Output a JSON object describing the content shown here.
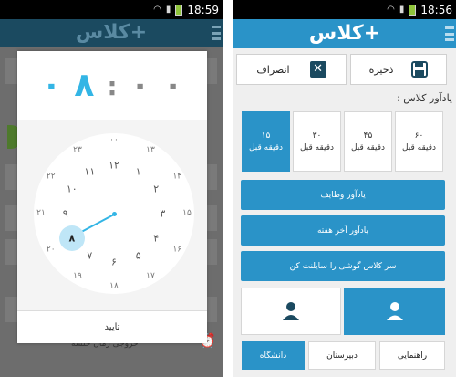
{
  "left": {
    "status_time": "18:59",
    "logo": "کلاس+",
    "time": {
      "hour_tens": "۰",
      "hour_ones": "۸",
      "colon": ":",
      "minute_tens": "۰",
      "minute_ones": "۰"
    },
    "clock": {
      "outer": [
        "۱۲",
        "۱",
        "۲",
        "۳",
        "۴",
        "۵",
        "۶",
        "۷",
        "۸",
        "۹",
        "۱۰",
        "۱۱"
      ],
      "inner": [
        "۰۰",
        "۱۳",
        "۱۴",
        "۱۵",
        "۱۶",
        "۱۷",
        "۱۸",
        "۱۹",
        "۲۰",
        "۲۱",
        "۲۲",
        "۲۳"
      ],
      "selected_hour": 8
    },
    "confirm_label": "تایید",
    "background_footer": "خروجی زمان جلسه"
  },
  "right": {
    "status_time": "18:56",
    "logo": "کلاس+",
    "save_label": "ذخیره",
    "cancel_label": "انصراف",
    "reminder_title": "یادآور کلاس :",
    "reminders": [
      {
        "value": "۶۰",
        "unit": "دقیقه قبل",
        "selected": false
      },
      {
        "value": "۴۵",
        "unit": "دقیقه قبل",
        "selected": false
      },
      {
        "value": "۳۰",
        "unit": "دقیقه قبل",
        "selected": false
      },
      {
        "value": "۱۵",
        "unit": "دقیقه قبل",
        "selected": true
      }
    ],
    "actions": [
      "یادآور وظایف",
      "یادآور آخر هفته",
      "سر کلاس گوشی را سایلنت کن"
    ],
    "levels": [
      {
        "label": "راهنمایی",
        "selected": false
      },
      {
        "label": "دبیرستان",
        "selected": false
      },
      {
        "label": "دانشگاه",
        "selected": true
      }
    ],
    "colors": {
      "accent": "#2a93c8",
      "dark": "#1b4a60",
      "clock_accent": "#33b5e5"
    }
  }
}
